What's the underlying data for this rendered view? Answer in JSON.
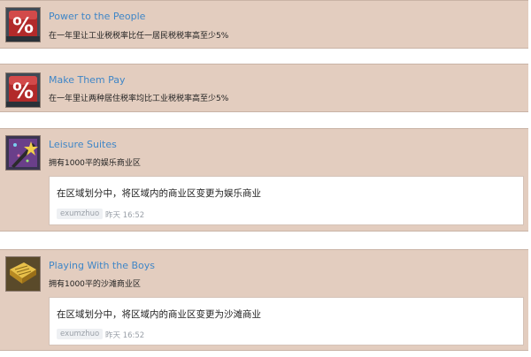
{
  "achievements": [
    {
      "icon": "percent-icon",
      "title": "Power to the People",
      "description": "在一年里让工业税税率比任一居民税税率高至少5%"
    },
    {
      "icon": "percent-icon",
      "title": "Make Them Pay",
      "description": "在一年里让两种居住税率均比工业税税率高至少5%"
    },
    {
      "icon": "magic-wand-icon",
      "title": "Leisure Suites",
      "description": "拥有1000平的娱乐商业区",
      "comment": {
        "text": "在区域划分中，将区域内的商业区变更为娱乐商业",
        "user": "exumzhuo",
        "time": "昨天 16:52"
      }
    },
    {
      "icon": "beach-map-icon",
      "title": "Playing With the Boys",
      "description": "拥有1000平的沙滩商业区",
      "comment": {
        "text": "在区域划分中，将区域内的商业区变更为沙滩商业",
        "user": "exumzhuo",
        "time": "昨天 16:52"
      }
    }
  ]
}
